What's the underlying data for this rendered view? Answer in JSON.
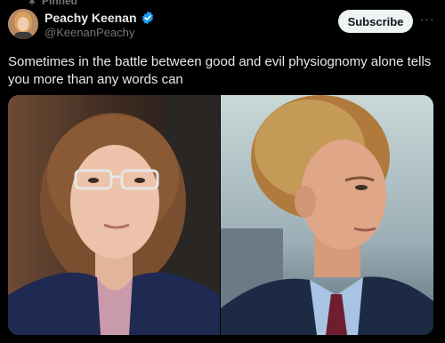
{
  "pinned_label": "Pinned",
  "author": {
    "display_name": "Peachy Keenan",
    "handle": "@KeenanPeachy",
    "verified": true
  },
  "actions": {
    "subscribe_label": "Subscribe",
    "more_label": "···"
  },
  "tweet": {
    "text": "Sometimes in the battle between good and evil physiognomy alone tells you more than any words can"
  },
  "colors": {
    "background": "#000000",
    "text_primary": "#e7e9ea",
    "text_secondary": "#71767b",
    "verified_blue": "#1d9bf0",
    "subscribe_bg": "#eff3f4"
  },
  "icons": {
    "pin": "pin-icon",
    "verified": "verified-badge-icon",
    "more": "more-horizontal-icon"
  }
}
